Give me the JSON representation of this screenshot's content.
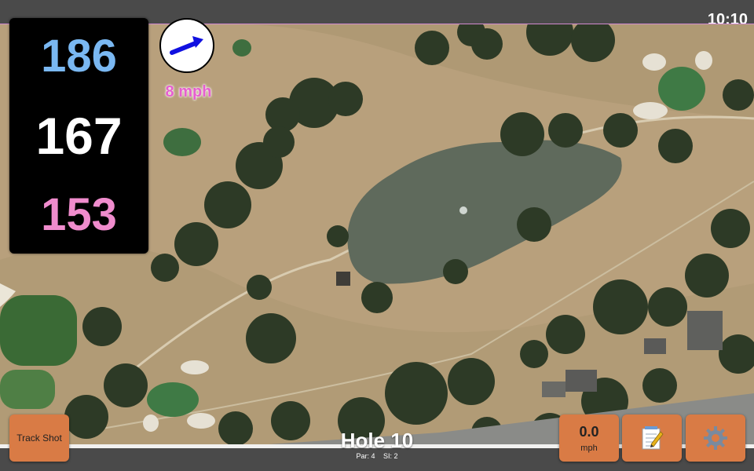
{
  "status": {
    "time": "10:10"
  },
  "distances": {
    "back": "186",
    "center": "167",
    "front": "153"
  },
  "wind": {
    "speed_label": "8 mph",
    "arrow_icon": "wind-direction-arrow-icon",
    "arrow_color": "#1010e0"
  },
  "buttons": {
    "track_shot": "Track Shot",
    "speed_value": "0.0",
    "speed_unit": "mph",
    "notes_icon": "notepad-pencil-icon",
    "settings_icon": "gear-icon"
  },
  "hole": {
    "title": "Hole 10",
    "par": "Par: 4",
    "si": "SI: 2"
  },
  "colors": {
    "back": "#7ab8f2",
    "center": "#ffffff",
    "front": "#f08ccd",
    "wind_text": "#e65fcf",
    "button": "#d97b45",
    "fairway": "#b79f7a",
    "water": "#5f6a5c",
    "green": "#3f7a45"
  }
}
